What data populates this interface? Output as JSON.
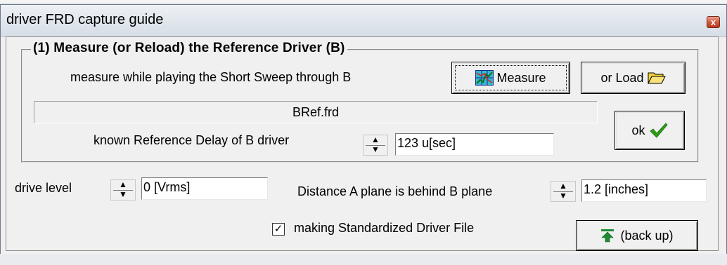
{
  "window": {
    "title": "driver FRD capture guide",
    "close_glyph": "x"
  },
  "group": {
    "title": "(1) Measure (or Reload) the Reference Driver (B)",
    "instruction": "measure while playing the Short Sweep through B",
    "measure_label": "Measure",
    "load_label": "or Load",
    "file_name": "BRef.frd",
    "delay_label": "known Reference Delay of B driver",
    "delay_value": "123 u[sec]",
    "ok_label": "ok"
  },
  "drive": {
    "label": "drive level",
    "value": "0 [Vrms]"
  },
  "distance": {
    "label": "Distance A plane is behind B plane",
    "value": "1.2 [inches]"
  },
  "standardized": {
    "label": "making Standardized Driver File",
    "checked": true,
    "check_glyph": "✓"
  },
  "back_up": {
    "label": "(back up)"
  },
  "spin_glyphs": {
    "up": "▲",
    "down": "▼"
  },
  "icons": {
    "measure": "measure-graph-icon",
    "load": "folder-open-icon",
    "ok": "green-checkmark-icon",
    "back_up": "up-arrow-icon"
  },
  "colors": {
    "check_green": "#2e9e14",
    "folder_yellow": "#f5d33a",
    "arrow_green": "#1e8a34",
    "measure_icon_bg": "#35b8d0"
  }
}
